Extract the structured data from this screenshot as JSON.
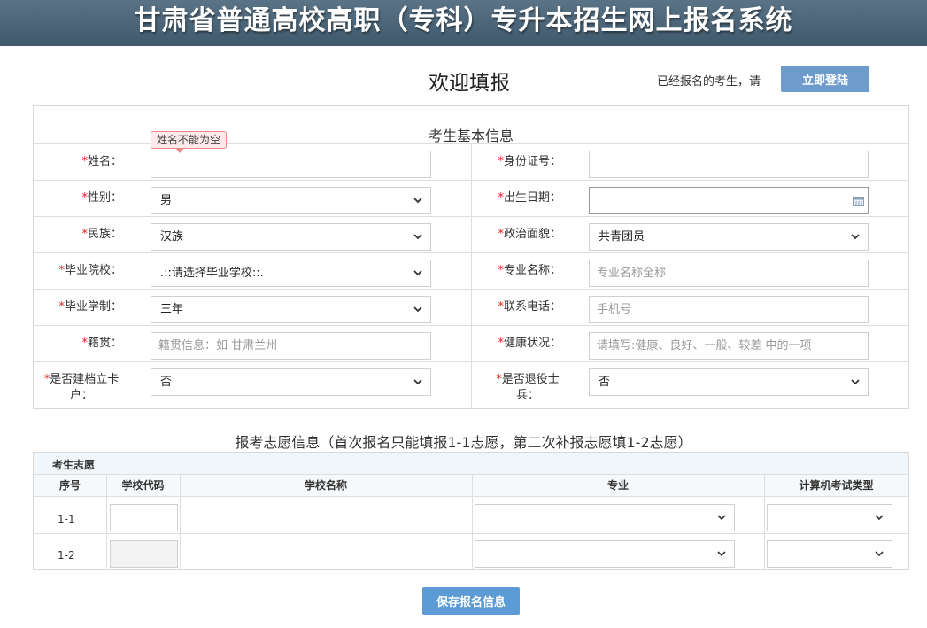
{
  "header": {
    "title": "甘肃省普通高校高职（专科）专升本招生网上报名系统"
  },
  "welcome": {
    "title": "欢迎填报",
    "already_text": "已经报名的考生，请",
    "login_label": "立即登陆"
  },
  "basic": {
    "section_title": "考生基本信息",
    "name_error_tip": "姓名不能为空",
    "required_mark": "*",
    "name_label": "姓名：",
    "id_label": "身份证号：",
    "gender_label": "性别：",
    "gender_value": "男",
    "birth_label": "出生日期：",
    "ethnicity_label": "民族：",
    "ethnicity_value": "汉族",
    "political_label": "政治面貌：",
    "political_value": "共青团员",
    "school_label": "毕业院校：",
    "school_value": ".::请选择毕业学校::.",
    "major_label": "专业名称：",
    "major_placeholder": "专业名称全称",
    "duration_label": "毕业学制：",
    "duration_value": "三年",
    "phone_label": "联系电话：",
    "phone_placeholder": "手机号",
    "native_label": "籍贯：",
    "native_placeholder": "籍贯信息：如 甘肃兰州",
    "health_label": "健康状况：",
    "health_placeholder": "请填写:健康、良好、一般、较差 中的一项",
    "poverty_label_1": "是否建档立卡",
    "poverty_label_2": "户：",
    "poverty_value": "否",
    "veteran_label_1": "是否退役士",
    "veteran_label_2": "兵：",
    "veteran_value": "否"
  },
  "wish": {
    "title": "报考志愿信息（首次报名只能填报1-1志愿，第二次补报志愿填1-2志愿）",
    "head_label": "考生志愿",
    "columns": [
      "序号",
      "学校代码",
      "学校名称",
      "专业",
      "计算机考试类型"
    ],
    "rows": [
      {
        "no": "1-1"
      },
      {
        "no": "1-2"
      }
    ]
  },
  "actions": {
    "save_label": "保存报名信息"
  },
  "colors": {
    "banner": "#4a6476",
    "button": "#6d9ccc",
    "required": "#e02020",
    "tip_border": "#e58a8a"
  },
  "icons": {
    "dropdown": "chevron-down-icon",
    "date": "calendar-icon"
  }
}
